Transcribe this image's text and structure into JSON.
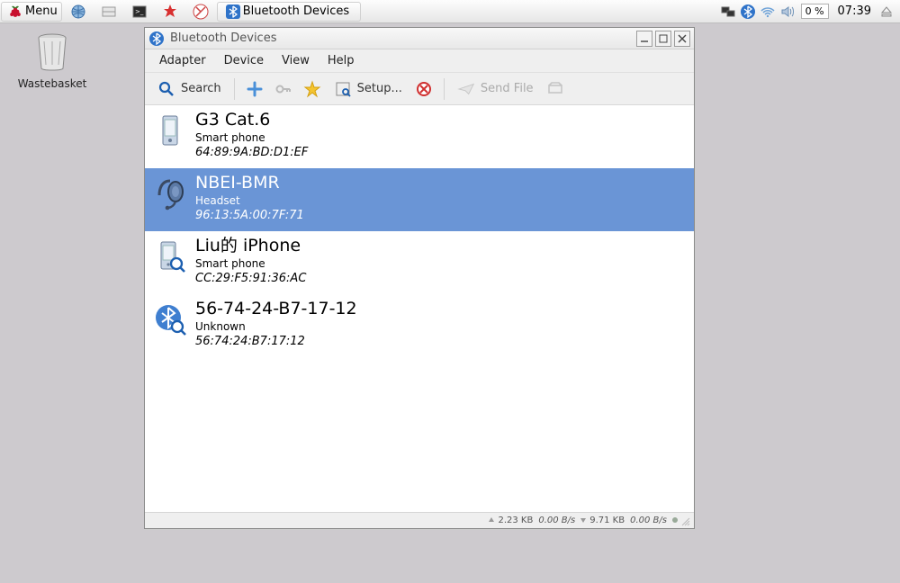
{
  "taskbar": {
    "menu_label": "Menu",
    "task_label": "Bluetooth Devices",
    "cpu": "0 %",
    "clock": "07:39"
  },
  "desktop": {
    "wastebasket_label": "Wastebasket"
  },
  "window": {
    "title": "Bluetooth Devices",
    "menus": {
      "adapter": "Adapter",
      "device": "Device",
      "view": "View",
      "help": "Help"
    },
    "toolbar": {
      "search": "Search",
      "setup": "Setup...",
      "send_file": "Send File"
    },
    "devices": [
      {
        "name": "G3 Cat.6",
        "type": "Smart phone",
        "address": "64:89:9A:BD:D1:EF",
        "icon": "phone",
        "selected": false
      },
      {
        "name": "NBEI-BMR",
        "type": "Headset",
        "address": "96:13:5A:00:7F:71",
        "icon": "headset",
        "selected": true
      },
      {
        "name": "Liu的 iPhone",
        "type": "Smart phone",
        "address": "CC:29:F5:91:36:AC",
        "icon": "phone-search",
        "selected": false
      },
      {
        "name": "56-74-24-B7-17-12",
        "type": "Unknown",
        "address": "56:74:24:B7:17:12",
        "icon": "bt-search",
        "selected": false
      }
    ],
    "status": {
      "up_kb": "2.23 KB",
      "up_rate": "0.00 B/s",
      "down_kb": "9.71 KB",
      "down_rate": "0.00 B/s"
    }
  }
}
